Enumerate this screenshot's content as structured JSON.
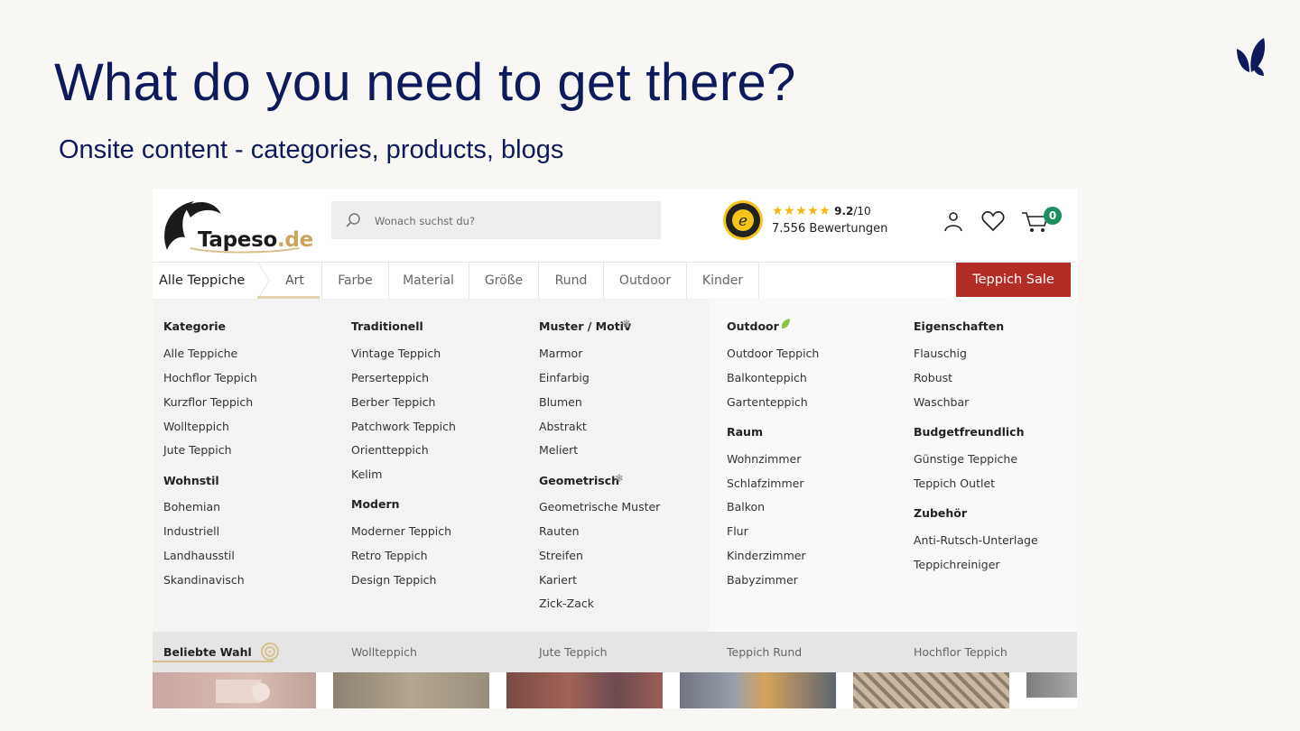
{
  "slide": {
    "title": "What do you need to get there?",
    "subtitle": "Onsite content - categories, products, blogs"
  },
  "site": {
    "logo_name": "Tapeso",
    "logo_tld": ".de",
    "search_placeholder": "Wonach suchst du?",
    "rating_score": "9.2",
    "rating_max": "/10",
    "rating_stars": "★★★★★",
    "reviews_text": "7.556 Bewertungen",
    "cart_count": "0",
    "nav": {
      "all": "Alle Teppiche",
      "items": [
        "Art",
        "Farbe",
        "Material",
        "Größe",
        "Rund",
        "Outdoor",
        "Kinder"
      ],
      "sale": "Teppich Sale"
    },
    "menu": {
      "col1": {
        "h1": "Kategorie",
        "links1": [
          "Alle Teppiche",
          "Hochflor Teppich",
          "Kurzflor Teppich",
          "Wollteppich",
          "Jute Teppich"
        ],
        "h2": "Wohnstil",
        "links2": [
          "Bohemian",
          "Industriell",
          "Landhausstil",
          "Skandinavisch"
        ]
      },
      "col2": {
        "h1": "Traditionell",
        "links1": [
          "Vintage Teppich",
          "Perserteppich",
          "Berber Teppich",
          "Patchwork Teppich",
          "Orientteppich",
          "Kelim"
        ],
        "h2": "Modern",
        "links2": [
          "Moderner Teppich",
          "Retro Teppich",
          "Design Teppich"
        ]
      },
      "col3": {
        "h1": "Muster / Motiv",
        "links1": [
          "Marmor",
          "Einfarbig",
          "Blumen",
          "Abstrakt",
          "Meliert"
        ],
        "h2": "Geometrisch",
        "links2": [
          "Geometrische Muster",
          "Rauten",
          "Streifen",
          "Kariert",
          "Zick-Zack"
        ]
      },
      "col4": {
        "h1": "Outdoor",
        "links1": [
          "Outdoor Teppich",
          "Balkonteppich",
          "Gartenteppich"
        ],
        "h2": "Raum",
        "links2": [
          "Wohnzimmer",
          "Schlafzimmer",
          "Balkon",
          "Flur",
          "Kinderzimmer",
          "Babyzimmer"
        ]
      },
      "col5": {
        "h1": "Eigenschaften",
        "links1": [
          "Flauschig",
          "Robust",
          "Waschbar"
        ],
        "h2": "Budgetfreundlich",
        "links2": [
          "Günstige Teppiche",
          "Teppich Outlet"
        ],
        "h3": "Zubehör",
        "links3": [
          "Anti-Rutsch-Unterlage",
          "Teppichreiniger"
        ]
      }
    },
    "popular": {
      "label": "Beliebte Wahl",
      "items": [
        "Wollteppich",
        "Jute Teppich",
        "Teppich Rund",
        "Hochflor Teppich"
      ]
    }
  },
  "colors": {
    "navy": "#0e1a5c",
    "sale_red": "#b42d25",
    "cart_green": "#1d8f5f",
    "star_yellow": "#f2b707",
    "logo_gold": "#c9a45c"
  }
}
